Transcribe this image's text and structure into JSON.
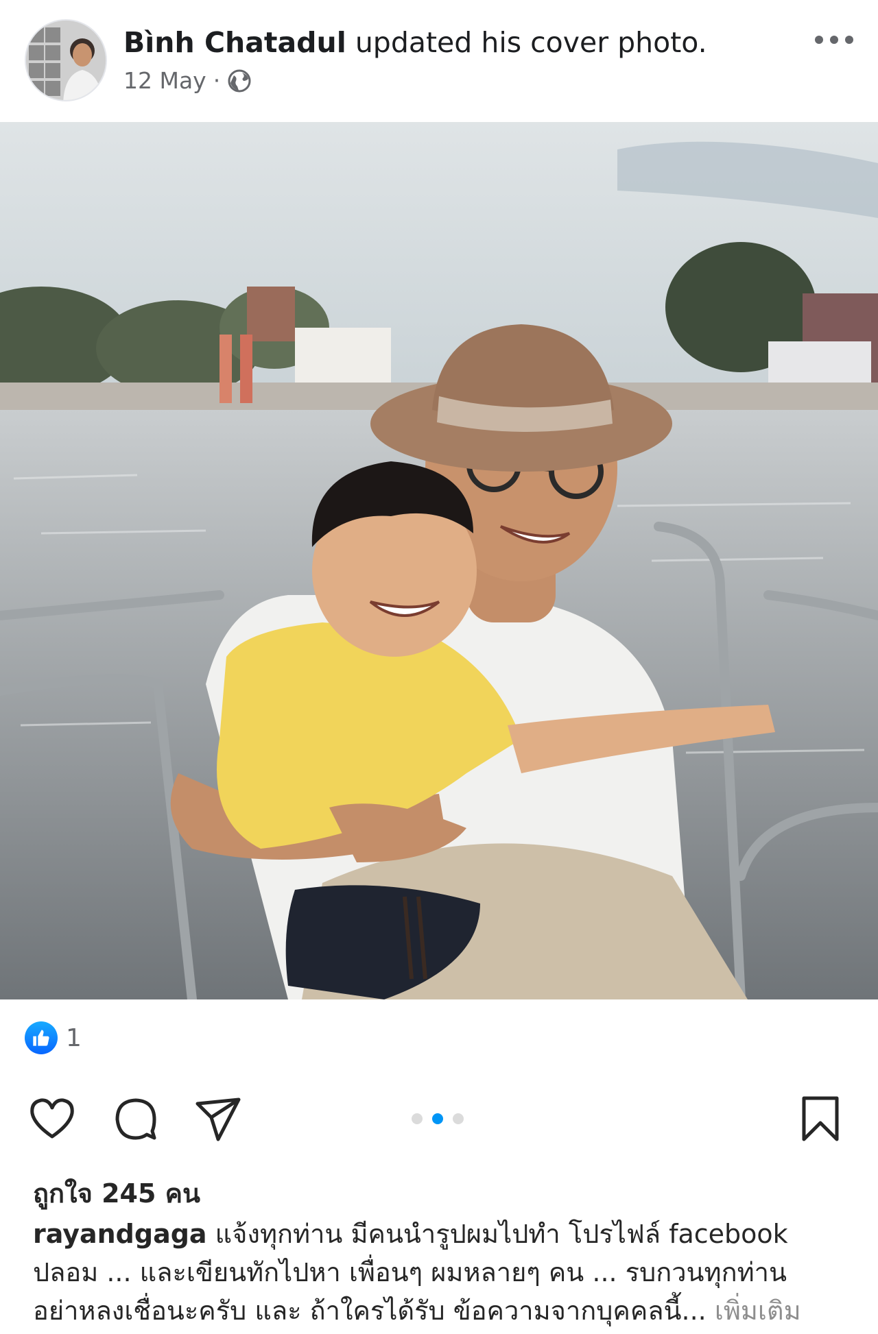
{
  "post": {
    "author": "Bình Chatadul",
    "action": "updated his cover photo.",
    "date": "12 May",
    "separator": "·",
    "privacy_icon": "globe-icon",
    "reactions": {
      "icon": "like-icon",
      "count": "1"
    }
  },
  "instagram": {
    "carousel": {
      "count": 3,
      "active": 1
    },
    "likes_text": "ถูกใจ 245 คน",
    "caption": {
      "username": "rayandgaga",
      "line1": "แจ้งทุกท่าน มีคนนำรูปผมไปทำ โปรไฟล์ facebook",
      "line2": "ปลอม ... และเขียนทักไปหา เพื่อนๆ ผมหลายๆ คน ... รบกวนทุกท่าน",
      "line3": "อย่าหลงเชื่อนะครับ และ ถ้าใครได้รับ ข้อความจากบุคคลนี้...",
      "more": "เพิ่มเติม"
    }
  },
  "colors": {
    "facebook_blue": "#0866ff",
    "instagram_blue": "#0095f6",
    "muted": "#65676b"
  }
}
